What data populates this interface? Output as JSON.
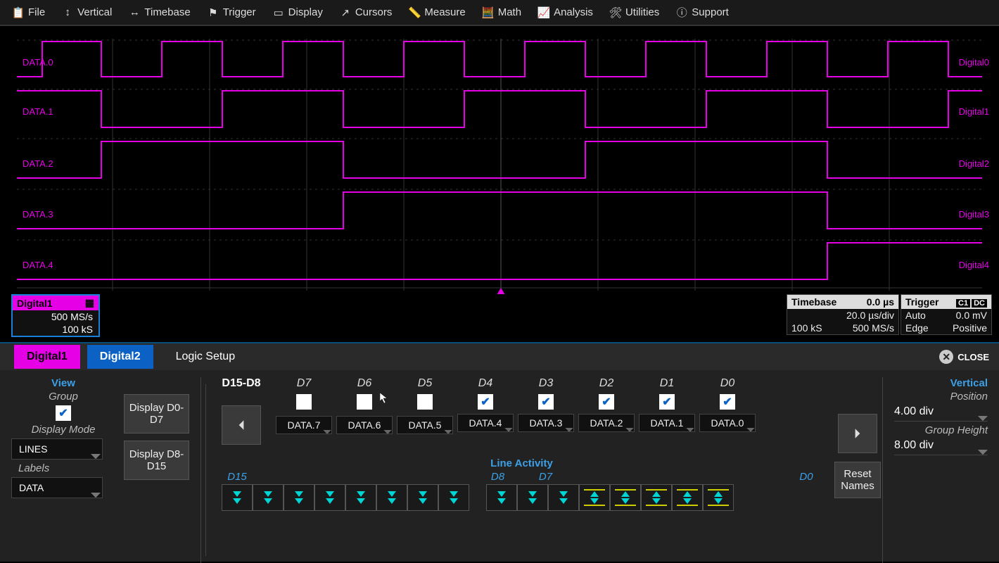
{
  "menu": {
    "items": [
      {
        "label": "File",
        "icon": "clipboard-icon"
      },
      {
        "label": "Vertical",
        "icon": "vertical-arrows-icon"
      },
      {
        "label": "Timebase",
        "icon": "horizontal-arrows-icon"
      },
      {
        "label": "Trigger",
        "icon": "flag-icon"
      },
      {
        "label": "Display",
        "icon": "display-icon"
      },
      {
        "label": "Cursors",
        "icon": "cursor-arrow-icon"
      },
      {
        "label": "Measure",
        "icon": "ruler-icon"
      },
      {
        "label": "Math",
        "icon": "math-icon"
      },
      {
        "label": "Analysis",
        "icon": "chart-icon"
      },
      {
        "label": "Utilities",
        "icon": "wrench-icon"
      },
      {
        "label": "Support",
        "icon": "info-icon"
      }
    ]
  },
  "waveform": {
    "left_labels": [
      "DATA.0",
      "DATA.1",
      "DATA.2",
      "DATA.3",
      "DATA.4"
    ],
    "right_labels": [
      "Digital0",
      "Digital1",
      "Digital2",
      "Digital3",
      "Digital4"
    ],
    "color": "#e600e6"
  },
  "digital_badge": {
    "title": "Digital1",
    "rate": "500 MS/s",
    "samples": "100 kS"
  },
  "timebase_box": {
    "title": "Timebase",
    "val1": "0.0 µs",
    "val2": "20.0 µs/div",
    "row3a": "100 kS",
    "row3b": "500 MS/s"
  },
  "trigger_box": {
    "title": "Trigger",
    "badge1": "C1",
    "badge2": "DC",
    "row2a": "Auto",
    "row2b": "0.0 mV",
    "row3a": "Edge",
    "row3b": "Positive"
  },
  "tabs": {
    "d1": "Digital1",
    "d2": "Digital2",
    "logic": "Logic Setup",
    "close": "CLOSE"
  },
  "view": {
    "title": "View",
    "group": "Group",
    "display_mode": "Display Mode",
    "lines": "LINES",
    "labels": "Labels",
    "data": "DATA"
  },
  "display_btns": {
    "d07": "Display D0-D7",
    "d815": "Display D8-D15"
  },
  "channels": {
    "range_label": "D15-D8",
    "cols": [
      {
        "dn": "D7",
        "name": "DATA.7",
        "checked": false
      },
      {
        "dn": "D6",
        "name": "DATA.6",
        "checked": false
      },
      {
        "dn": "D5",
        "name": "DATA.5",
        "checked": false
      },
      {
        "dn": "D4",
        "name": "DATA.4",
        "checked": true
      },
      {
        "dn": "D3",
        "name": "DATA.3",
        "checked": true
      },
      {
        "dn": "D2",
        "name": "DATA.2",
        "checked": true
      },
      {
        "dn": "D1",
        "name": "DATA.1",
        "checked": true
      },
      {
        "dn": "D0",
        "name": "DATA.0",
        "checked": true
      }
    ],
    "reset": "Reset Names"
  },
  "vertical": {
    "title": "Vertical",
    "position": "Position",
    "position_val": "4.00 div",
    "group_height": "Group Height",
    "group_height_val": "8.00 div"
  },
  "line_activity": {
    "title": "Line Activity",
    "left": "D15",
    "mid": "D8",
    "mid2": "D7",
    "right": "D0"
  }
}
